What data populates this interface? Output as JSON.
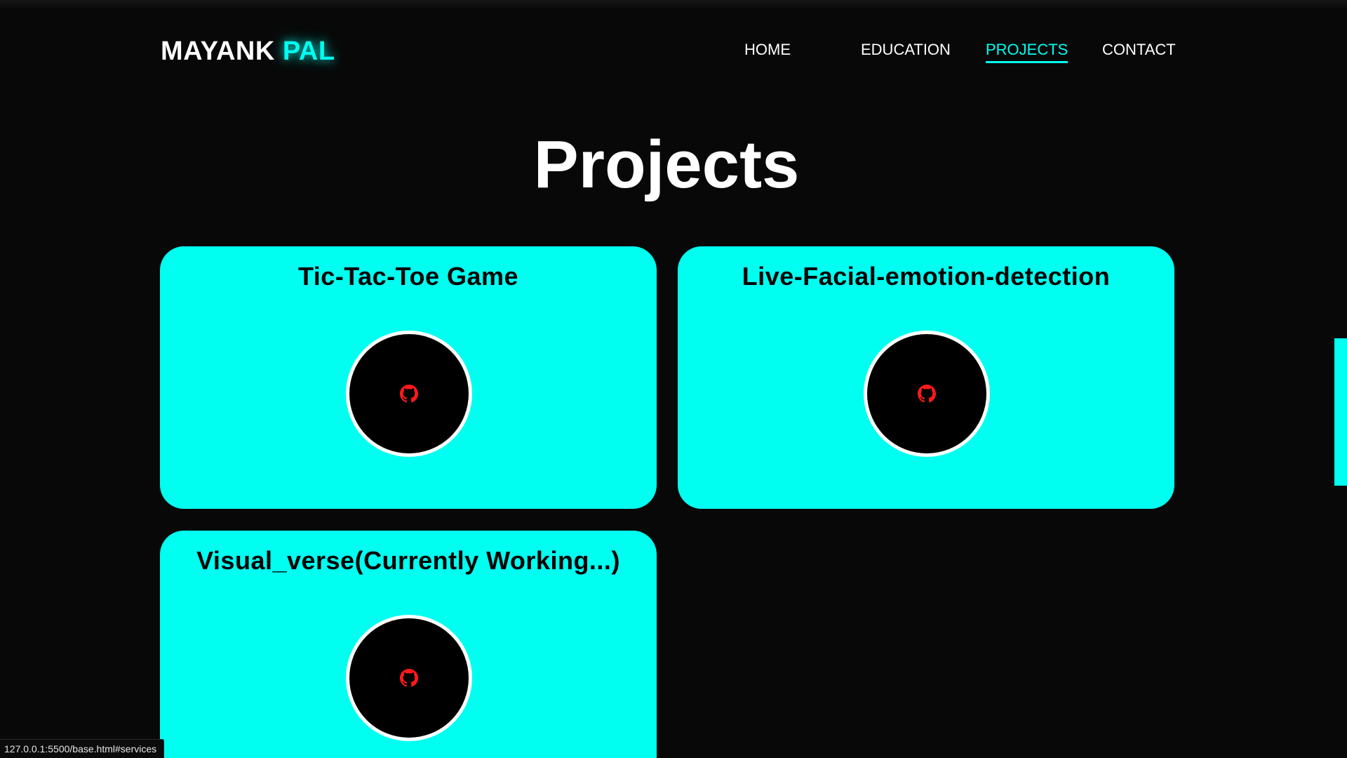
{
  "header": {
    "logo_first": "MAYANK",
    "logo_second": "PAL"
  },
  "nav": {
    "items": [
      {
        "label": "HOME"
      },
      {
        "label": "EDUCATION"
      },
      {
        "label": "PROJECTS",
        "active": true
      },
      {
        "label": "CONTACT"
      }
    ]
  },
  "main": {
    "title": "Projects",
    "projects": [
      {
        "title": "Tic-Tac-Toe Game",
        "link_icon": "github-icon"
      },
      {
        "title": "Live-Facial-emotion-detection",
        "link_icon": "github-icon"
      },
      {
        "title": "Visual_verse(Currently Working...)",
        "link_icon": "github-icon"
      }
    ]
  },
  "status_bar": {
    "url": "127.0.0.1:5500/base.html#services"
  },
  "colors": {
    "background": "#080808",
    "accent": "#00fff0",
    "github_icon": "#ff1a1a",
    "text": "#ffffff"
  }
}
